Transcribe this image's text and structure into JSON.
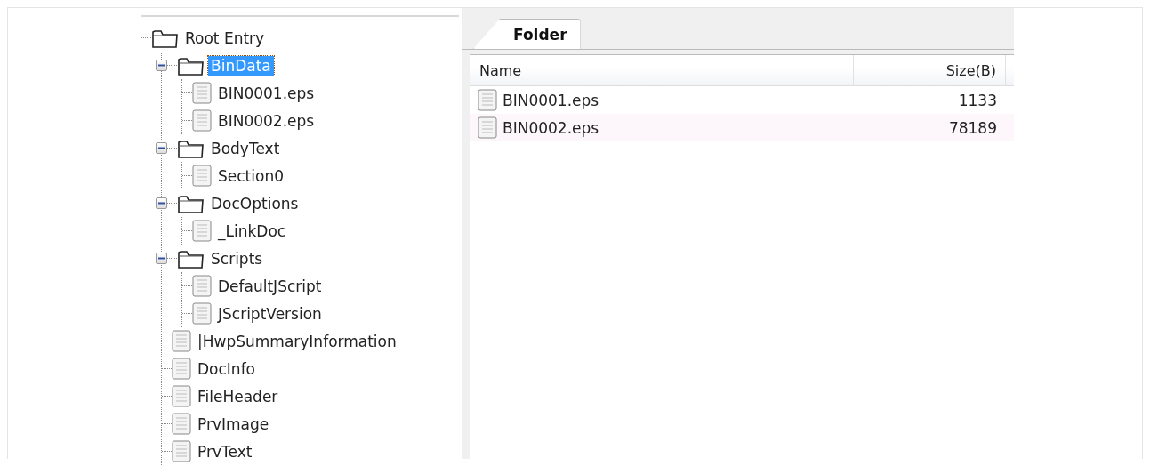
{
  "tree": [
    {
      "label": "Root Entry",
      "kind": "folder",
      "selected": false,
      "children": [
        {
          "label": "BinData",
          "kind": "folder",
          "selected": true,
          "expanded": true,
          "children": [
            {
              "label": "BIN0001.eps",
              "kind": "file",
              "selected": false
            },
            {
              "label": "BIN0002.eps",
              "kind": "file",
              "selected": false
            }
          ]
        },
        {
          "label": "BodyText",
          "kind": "folder",
          "selected": false,
          "expanded": true,
          "children": [
            {
              "label": "Section0",
              "kind": "file",
              "selected": false
            }
          ]
        },
        {
          "label": "DocOptions",
          "kind": "folder",
          "selected": false,
          "expanded": true,
          "children": [
            {
              "label": "_LinkDoc",
              "kind": "file",
              "selected": false
            }
          ]
        },
        {
          "label": "Scripts",
          "kind": "folder",
          "selected": false,
          "expanded": true,
          "children": [
            {
              "label": "DefaultJScript",
              "kind": "file",
              "selected": false
            },
            {
              "label": "JScriptVersion",
              "kind": "file",
              "selected": false
            }
          ]
        },
        {
          "label": "|HwpSummaryInformation",
          "kind": "file",
          "selected": false
        },
        {
          "label": "DocInfo",
          "kind": "file",
          "selected": false
        },
        {
          "label": "FileHeader",
          "kind": "file",
          "selected": false
        },
        {
          "label": "PrvImage",
          "kind": "file",
          "selected": false
        },
        {
          "label": "PrvText",
          "kind": "file",
          "selected": false
        }
      ]
    }
  ],
  "tabs": [
    {
      "label": "Folder",
      "selected": true
    }
  ],
  "table": {
    "columns": [
      "Name",
      "Size(B)"
    ],
    "rows": [
      {
        "name": "BIN0001.eps",
        "size": "1133"
      },
      {
        "name": "BIN0002.eps",
        "size": "78189"
      }
    ]
  }
}
